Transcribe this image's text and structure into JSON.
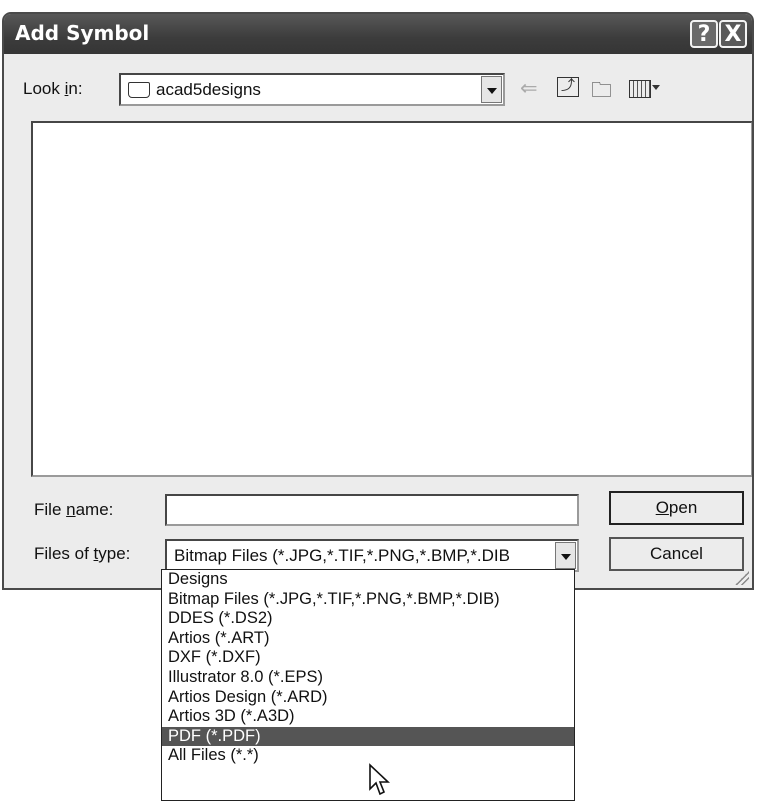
{
  "dialog": {
    "title": "Add Symbol",
    "help_label": "?",
    "close_label": "X"
  },
  "lookin": {
    "label_pre": "Look ",
    "label_ul": "i",
    "label_post": "n:",
    "value": "acad5designs"
  },
  "toolbar": {
    "icons": [
      "back-icon",
      "up-one-level-icon",
      "new-folder-icon",
      "view-menu-icon"
    ]
  },
  "filename": {
    "label_pre": "File ",
    "label_ul": "n",
    "label_post": "ame:",
    "value": ""
  },
  "filetype": {
    "label_pre": "Files of ",
    "label_ul": "t",
    "label_post": "ype:",
    "value": "Bitmap Files (*.JPG,*.TIF,*.PNG,*.BMP,*.DIB",
    "options": [
      "Designs",
      "Bitmap Files (*.JPG,*.TIF,*.PNG,*.BMP,*.DIB)",
      "DDES (*.DS2)",
      "Artios (*.ART)",
      "DXF (*.DXF)",
      "Illustrator 8.0 (*.EPS)",
      "Artios Design (*.ARD)",
      "Artios 3D (*.A3D)",
      "PDF (*.PDF)",
      "All Files (*.*)"
    ],
    "highlighted": "PDF (*.PDF)"
  },
  "buttons": {
    "open_ul": "O",
    "open_rest": "pen",
    "cancel": "Cancel"
  }
}
